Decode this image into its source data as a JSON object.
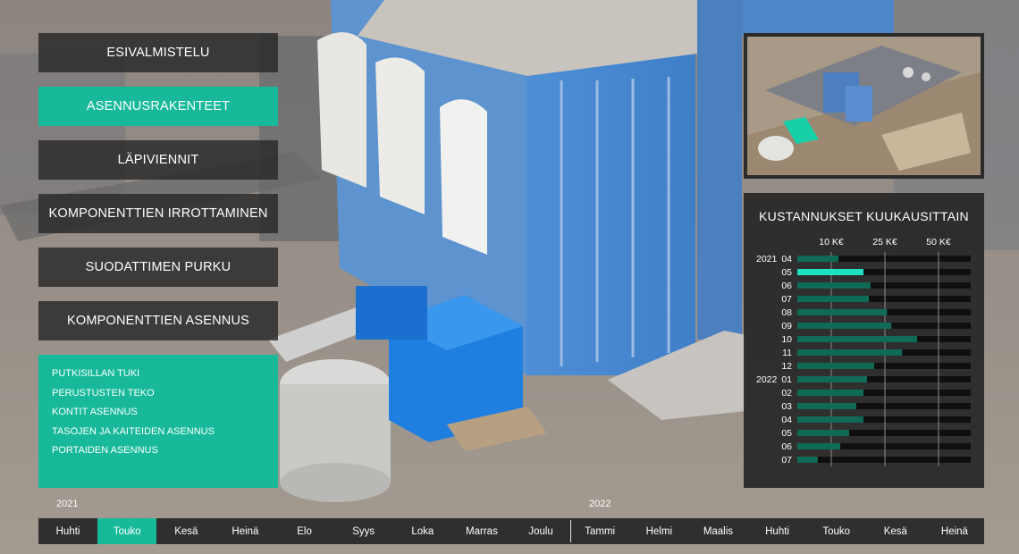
{
  "menu": {
    "items": [
      {
        "label": "ESIVALMISTELU",
        "active": false
      },
      {
        "label": "ASENNUSRAKENTEET",
        "active": true
      },
      {
        "label": "LÄPIVIENNIT",
        "active": false
      },
      {
        "label": "KOMPONENTTIEN IRROTTAMINEN",
        "active": false
      },
      {
        "label": "SUODATTIMEN PURKU",
        "active": false
      },
      {
        "label": "KOMPONENTTIEN ASENNUS",
        "active": false
      }
    ]
  },
  "submenu": {
    "items": [
      {
        "label": "PUTKISILLAN TUKI"
      },
      {
        "label": "PERUSTUSTEN TEKO"
      },
      {
        "label": "KONTIT ASENNUS"
      },
      {
        "label": "TASOJEN JA KAITEIDEN ASENNUS"
      },
      {
        "label": "PORTAIDEN ASENNUS"
      }
    ]
  },
  "colors": {
    "accent": "#17b99a",
    "bar_dark": "#0f6b56",
    "bar_highlight": "#1fe0c4",
    "bar_track": "#0f0f0f",
    "panel": "#262626"
  },
  "chart_data": {
    "type": "bar",
    "orientation": "horizontal",
    "title": "KUSTANNUKSET KUUKAUSITTAIN",
    "xticks": [
      "10 K€",
      "25 K€",
      "50 K€"
    ],
    "xtick_values": [
      10,
      25,
      50
    ],
    "unit": "K€",
    "categories": [
      {
        "year": "2021",
        "month": "04"
      },
      {
        "year": "",
        "month": "05"
      },
      {
        "year": "",
        "month": "06"
      },
      {
        "year": "",
        "month": "07"
      },
      {
        "year": "",
        "month": "08"
      },
      {
        "year": "",
        "month": "09"
      },
      {
        "year": "",
        "month": "10"
      },
      {
        "year": "",
        "month": "11"
      },
      {
        "year": "",
        "month": "12"
      },
      {
        "year": "2022",
        "month": "01"
      },
      {
        "year": "",
        "month": "02"
      },
      {
        "year": "",
        "month": "03"
      },
      {
        "year": "",
        "month": "04"
      },
      {
        "year": "",
        "month": "05"
      },
      {
        "year": "",
        "month": "06"
      },
      {
        "year": "",
        "month": "07"
      }
    ],
    "values": [
      12,
      19,
      21,
      20.5,
      26,
      28,
      40,
      33,
      22,
      20,
      19,
      17,
      19,
      15,
      12.5,
      6
    ],
    "highlight_index": 1
  },
  "timeline": {
    "years": [
      {
        "label": "2021"
      },
      {
        "label": "2022"
      }
    ],
    "months": [
      {
        "label": "Huhti",
        "active": false
      },
      {
        "label": "Touko",
        "active": true
      },
      {
        "label": "Kesä",
        "active": false
      },
      {
        "label": "Heinä",
        "active": false
      },
      {
        "label": "Elo",
        "active": false
      },
      {
        "label": "Syys",
        "active": false
      },
      {
        "label": "Loka",
        "active": false
      },
      {
        "label": "Marras",
        "active": false
      },
      {
        "label": "Joulu",
        "active": false
      },
      {
        "label": "Tammi",
        "active": false
      },
      {
        "label": "Helmi",
        "active": false
      },
      {
        "label": "Maalis",
        "active": false
      },
      {
        "label": "Huhti",
        "active": false
      },
      {
        "label": "Touko",
        "active": false
      },
      {
        "label": "Kesä",
        "active": false
      },
      {
        "label": "Heinä",
        "active": false
      }
    ]
  }
}
